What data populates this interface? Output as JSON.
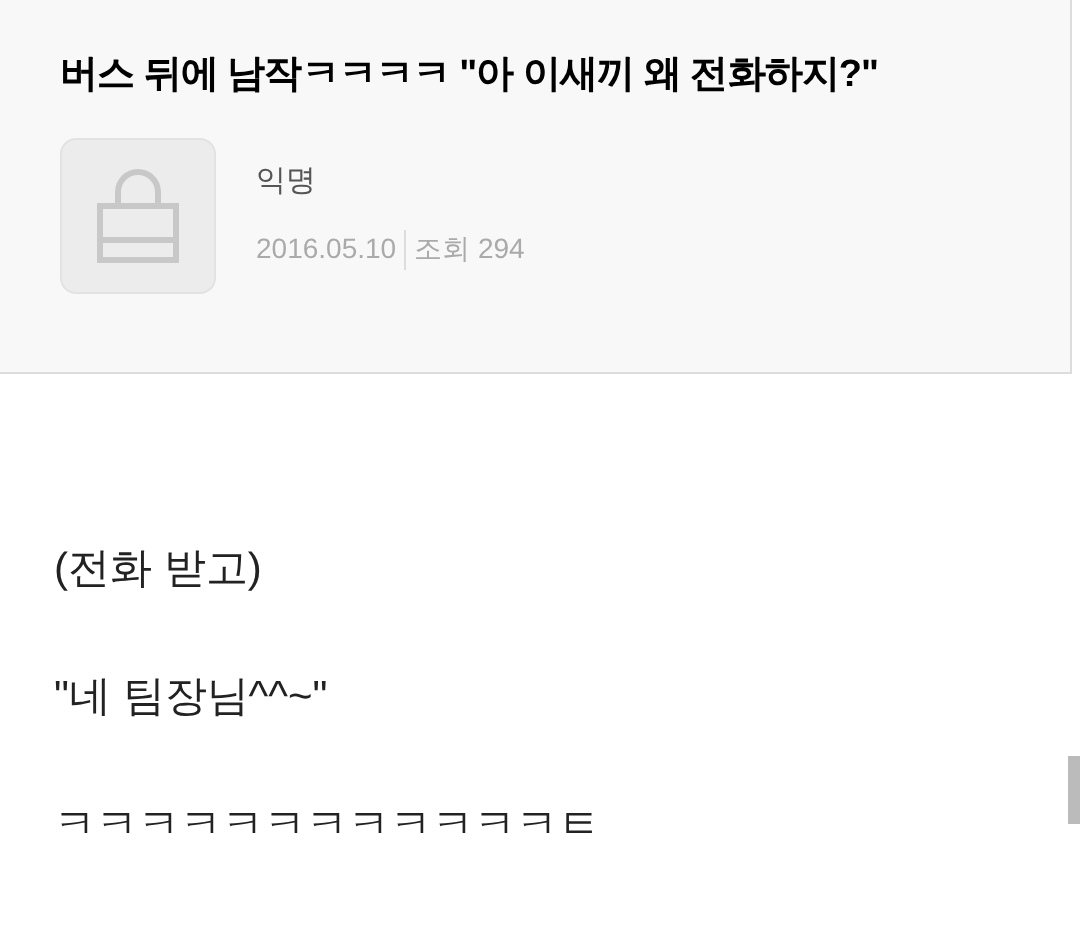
{
  "post": {
    "title": "버스 뒤에 남작ㅋㅋㅋㅋ \"아 이새끼 왜 전화하지?\"",
    "author": "익명",
    "date": "2016.05.10",
    "views": "조회 294"
  },
  "body": [
    "(전화 받고)",
    "\"네 팀장님^^~\"",
    "ㅋㅋㅋㅋㅋㅋㅋㅋㅋㅋㅋㅋㅌ"
  ]
}
